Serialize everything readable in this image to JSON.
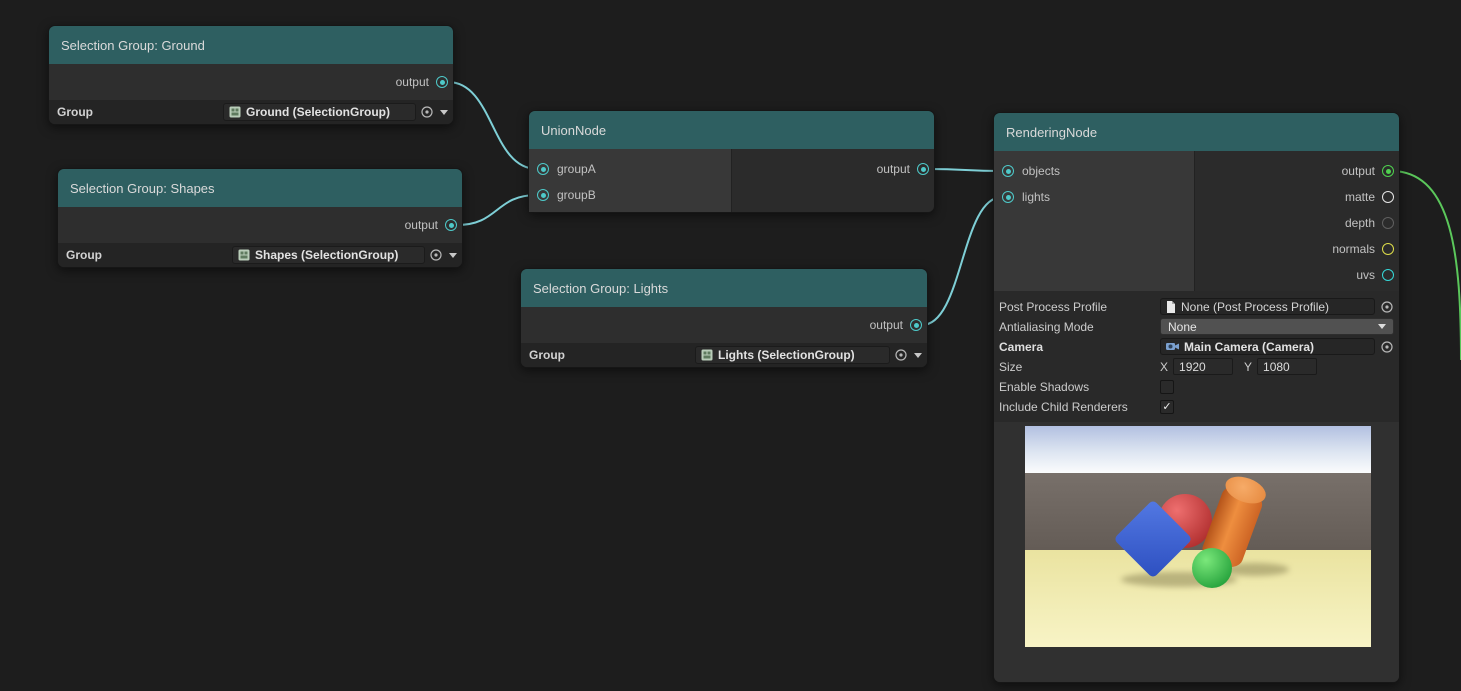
{
  "colors": {
    "title_bar": "#2e5f61",
    "wire_teal": "#7ecfd6",
    "wire_green": "#5bc75b",
    "port_teal": "#4ec9c9",
    "port_green": "#4fd14f",
    "port_matte": "#e6e6e6",
    "port_depth": "#5f5f5f",
    "port_normals": "#dede4a",
    "port_uvs": "#35d8d8"
  },
  "nodes": {
    "ground": {
      "title": "Selection Group: Ground",
      "output_label": "output",
      "group_label": "Group",
      "group_value": "Ground (SelectionGroup)"
    },
    "shapes": {
      "title": "Selection Group: Shapes",
      "output_label": "output",
      "group_label": "Group",
      "group_value": "Shapes (SelectionGroup)"
    },
    "lights_group": {
      "title": "Selection Group: Lights",
      "output_label": "output",
      "group_label": "Group",
      "group_value": "Lights (SelectionGroup)"
    },
    "union": {
      "title": "UnionNode",
      "inputs": [
        {
          "label": "groupA"
        },
        {
          "label": "groupB"
        }
      ],
      "output_label": "output"
    },
    "rendering": {
      "title": "RenderingNode",
      "inputs": [
        {
          "label": "objects"
        },
        {
          "label": "lights"
        }
      ],
      "outputs": [
        {
          "label": "output"
        },
        {
          "label": "matte"
        },
        {
          "label": "depth"
        },
        {
          "label": "normals"
        },
        {
          "label": "uvs"
        }
      ],
      "props": {
        "post_process_label": "Post Process Profile",
        "post_process_value": "None (Post Process Profile)",
        "antialiasing_label": "Antialiasing Mode",
        "antialiasing_value": "None",
        "camera_label": "Camera",
        "camera_value": "Main Camera (Camera)",
        "size_label": "Size",
        "x_label": "X",
        "x_value": "1920",
        "y_label": "Y",
        "y_value": "1080",
        "enable_shadows_label": "Enable Shadows",
        "enable_shadows_checked": false,
        "include_child_label": "Include Child Renderers",
        "include_child_checked": true
      }
    }
  },
  "preview": {
    "colors": {
      "sky_top": "#b2c0e1",
      "sky_bottom": "#fbfcfd",
      "backdrop": "#6b635d",
      "ground": "#f1ecae",
      "cube_blue": "#3f63d2",
      "sphere_red": "#cc4444",
      "cylinder_orange": "#e07f33",
      "sphere_green": "#3cc455"
    }
  }
}
